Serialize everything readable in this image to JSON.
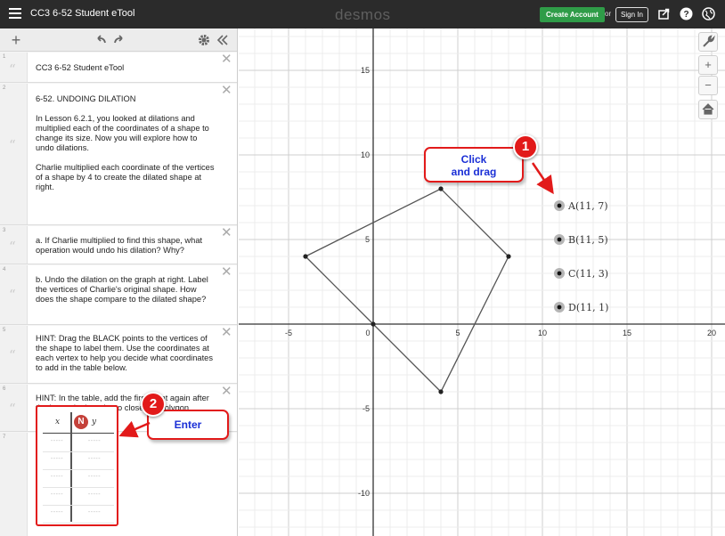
{
  "topbar": {
    "title": "CC3 6-52 Student eTool",
    "brand": "desmos",
    "create_account": "Create Account",
    "or": "or",
    "sign_in": "Sign In"
  },
  "expressions": [
    {
      "num": "1",
      "text": "CC3 6-52 Student eTool"
    },
    {
      "num": "2",
      "paragraphs": [
        "6-52. UNDOING DILATION",
        "In Lesson 6.2.1, you looked at dilations and multiplied each of the coordinates of a shape to change its size. Now you will explore how to undo dilations.",
        "Charlie multiplied each coordinate of the vertices of a shape by 4 to create the dilated shape at right."
      ]
    },
    {
      "num": "3",
      "text": "a. If Charlie multiplied to find this shape, what operation would undo his dilation? Why?"
    },
    {
      "num": "4",
      "text": "b. Undo the dilation on the graph at right. Label the vertices of Charlie's original shape. How does the shape compare to the dilated shape?"
    },
    {
      "num": "5",
      "text": "HINT: Drag the BLACK points to the vertices of the shape to label them. Use the coordinates at each vertex to help you decide what coordinates to add in the table below."
    },
    {
      "num": "6",
      "text": "HINT: In the table, add the first point again after the last point in order to close the polygon."
    },
    {
      "num": "7"
    }
  ],
  "table": {
    "col_x": "x",
    "col_y": "y",
    "placeholder": "-----",
    "rows": 5
  },
  "graph": {
    "x_ticks": [
      "-5",
      "0",
      "5",
      "10",
      "15",
      "20"
    ],
    "y_ticks": [
      "15",
      "10",
      "5",
      "-5",
      "-10"
    ],
    "polygon": [
      [
        -4,
        4
      ],
      [
        4,
        8
      ],
      [
        8,
        4
      ],
      [
        4,
        -4
      ],
      [
        0,
        0
      ]
    ],
    "points": [
      {
        "label": "A(11, 7)",
        "x": 11,
        "y": 7
      },
      {
        "label": "B(11, 5)",
        "x": 11,
        "y": 5
      },
      {
        "label": "C(11, 3)",
        "x": 11,
        "y": 3
      },
      {
        "label": "D(11, 1)",
        "x": 11,
        "y": 1
      }
    ],
    "line_color": "#555555",
    "point_color": "#222222"
  },
  "annotations": {
    "callout1": {
      "badge": "1",
      "line1": "Click",
      "line2": "and drag"
    },
    "callout2": {
      "badge": "2",
      "text": "Enter"
    },
    "accent_color": "#e21a1a",
    "text_color": "#1a2fd6"
  }
}
